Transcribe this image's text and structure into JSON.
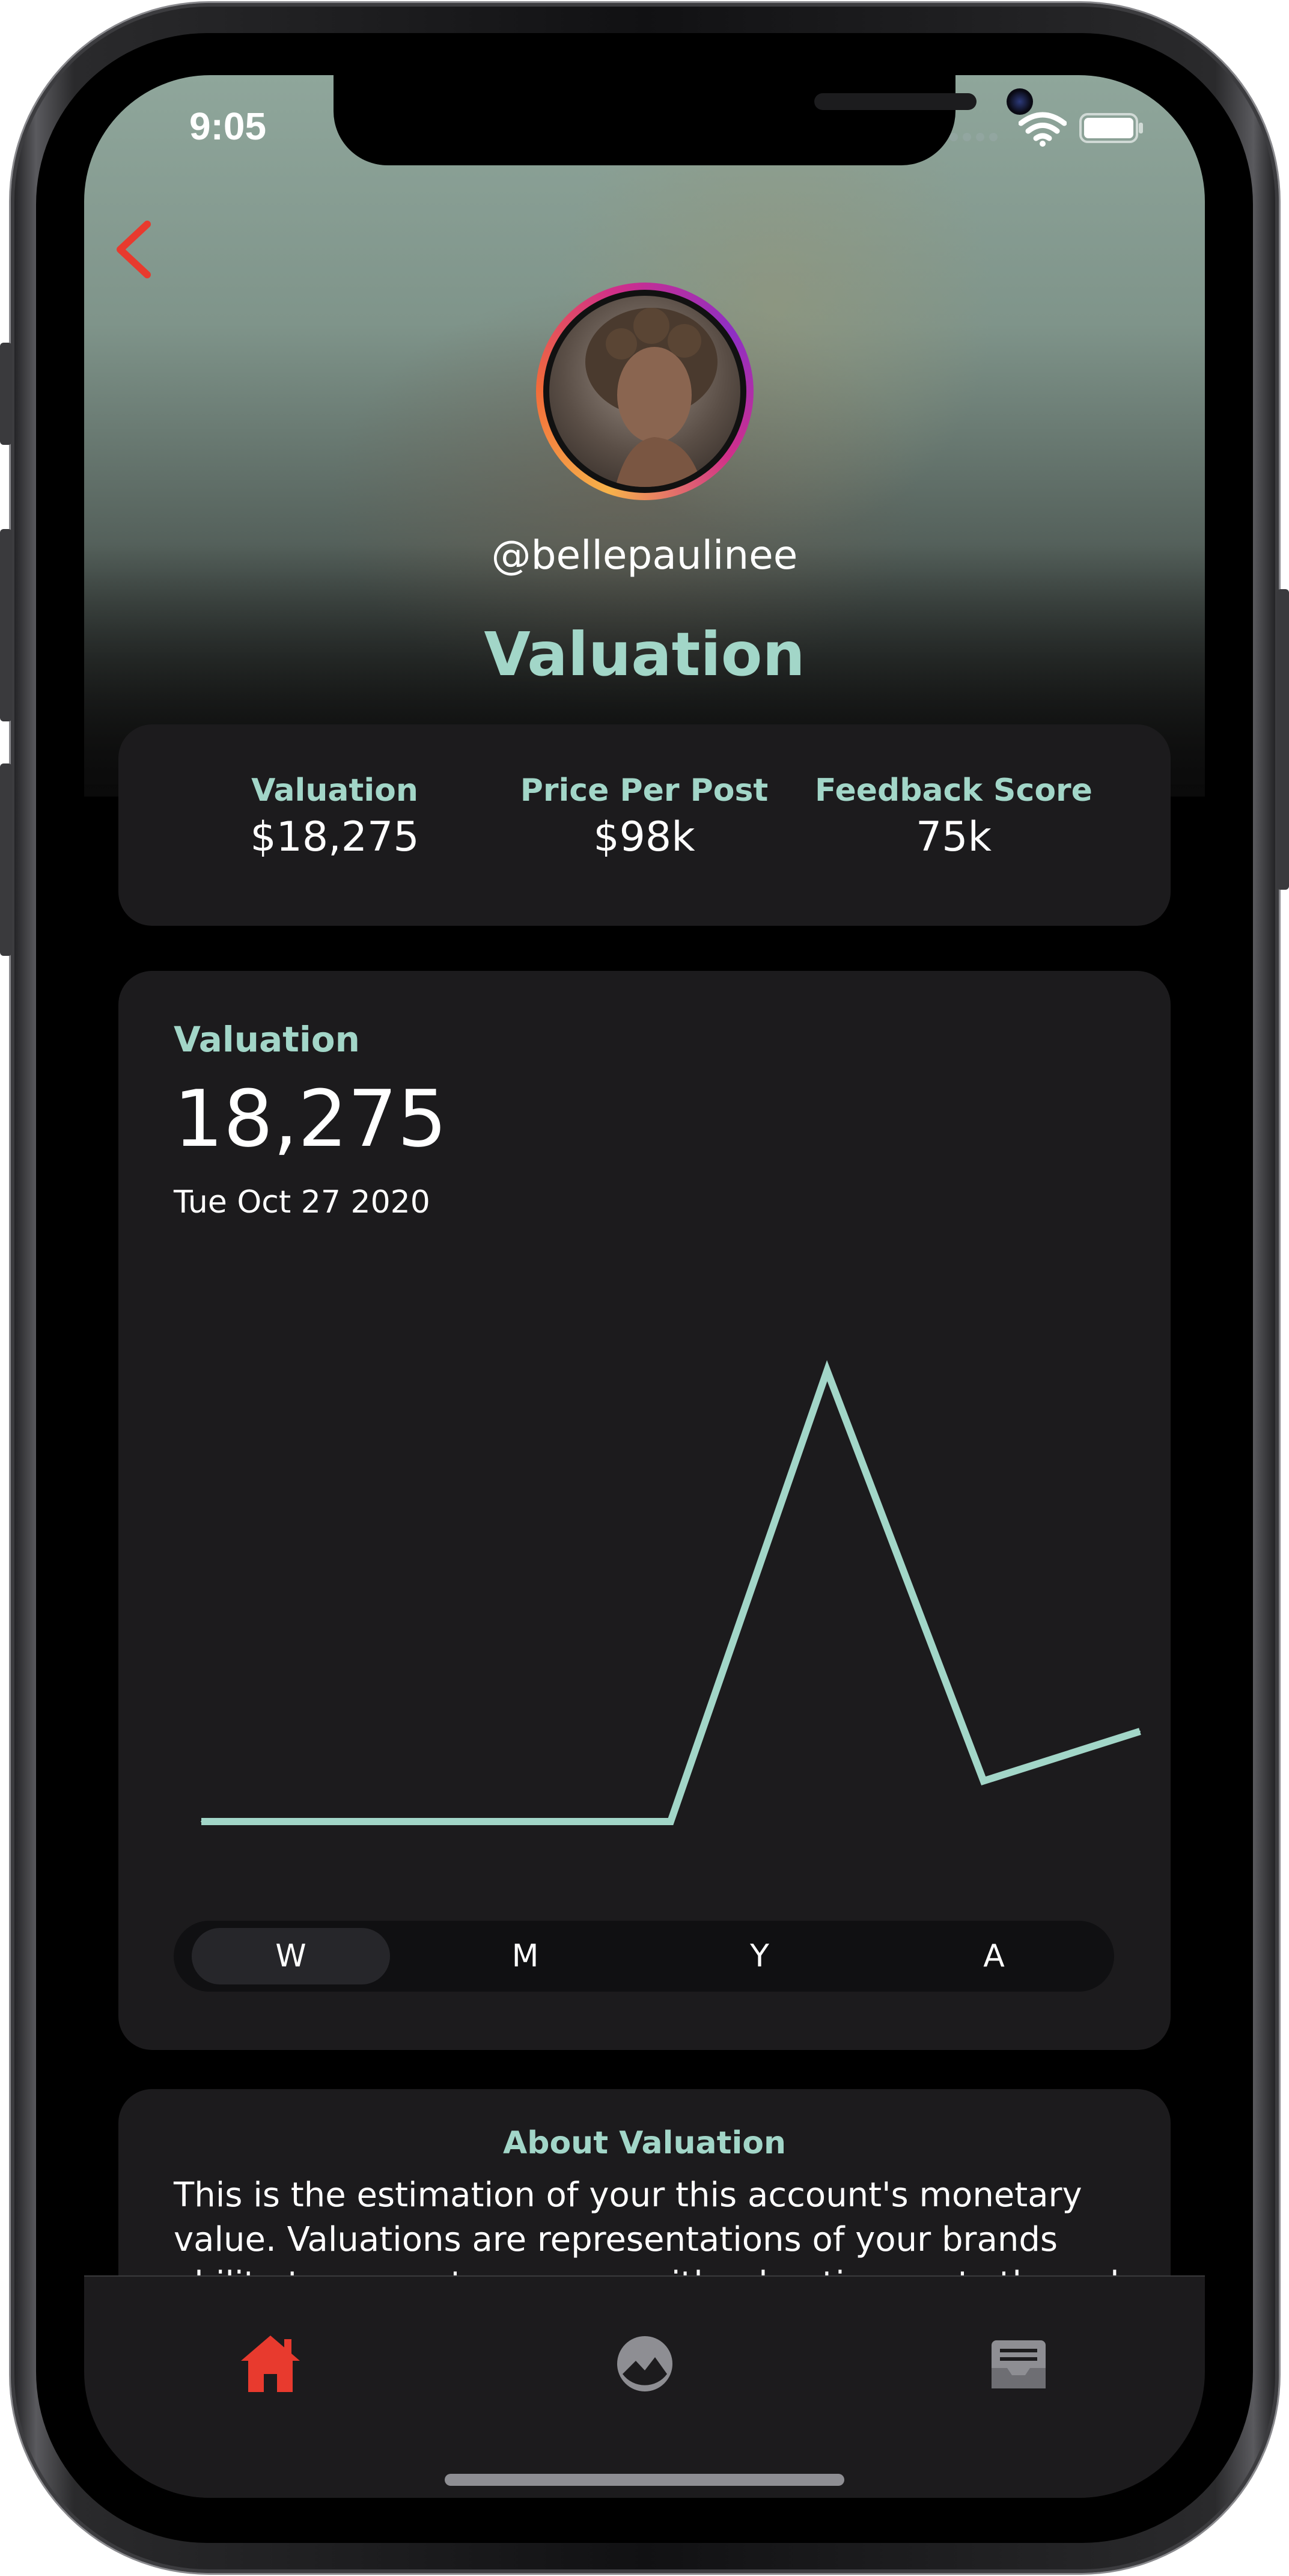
{
  "status_bar": {
    "time": "9:05"
  },
  "profile": {
    "username": "@bellepaulinee"
  },
  "page": {
    "title": "Valuation"
  },
  "stats": [
    {
      "label": "Valuation",
      "value": "$18,275"
    },
    {
      "label": "Price Per Post",
      "value": "$98k"
    },
    {
      "label": "Feedback Score",
      "value": "75k"
    }
  ],
  "chart_card": {
    "label": "Valuation",
    "value": "18,275",
    "date": "Tue Oct 27 2020"
  },
  "chart_data": {
    "type": "line",
    "color": "#a2d6c8",
    "x": [
      1,
      2,
      3,
      4,
      5,
      6,
      7
    ],
    "values": [
      0,
      0,
      0,
      0,
      100,
      9,
      20
    ],
    "ylim": [
      0,
      100
    ]
  },
  "range_tabs": [
    {
      "label": "W",
      "active": true
    },
    {
      "label": "M",
      "active": false
    },
    {
      "label": "Y",
      "active": false
    },
    {
      "label": "A",
      "active": false
    }
  ],
  "about": {
    "title": "About Valuation",
    "text": "This is the estimation of your this account's monetary value. Valuations are representations of your brands ability to generate revenue with advertisements through your"
  },
  "tabbar": {
    "items": [
      {
        "icon": "home-icon",
        "active": true
      },
      {
        "icon": "chart-gauge-icon",
        "active": false
      },
      {
        "icon": "inbox-icon",
        "active": false
      }
    ],
    "active_color": "#e83a2e",
    "inactive_color": "#8e8e93"
  },
  "colors": {
    "accent": "#a2d6c8",
    "back": "#e83a2e",
    "card": "#1c1b1d"
  }
}
